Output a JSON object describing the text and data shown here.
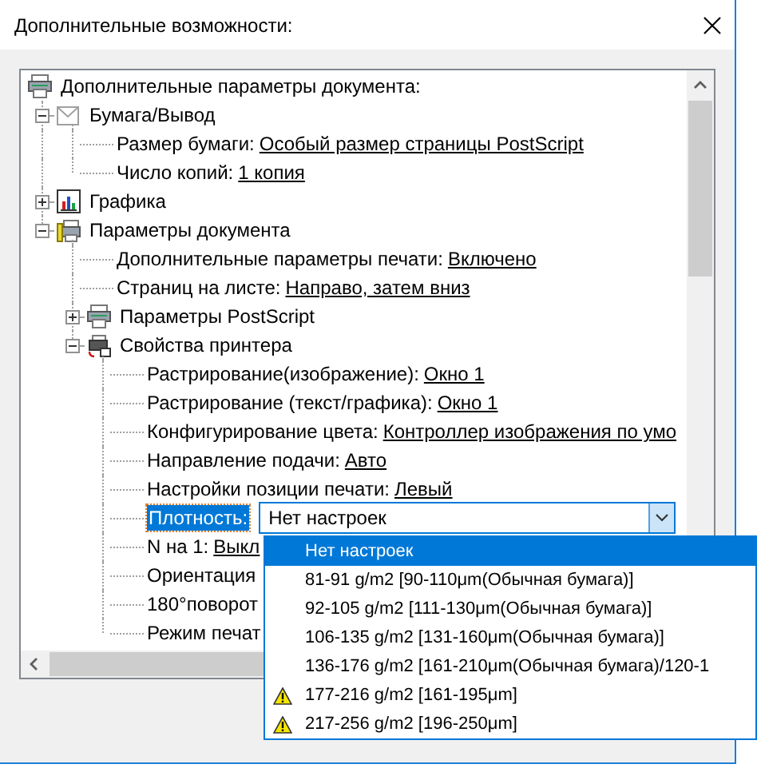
{
  "window": {
    "title": "Дополнительные возможности:"
  },
  "tree": {
    "label": "Дополнительные параметры документа:",
    "kind": "printer",
    "children": [
      {
        "label": "Бумага/Вывод",
        "kind": "paper",
        "expanded": true,
        "children": [
          {
            "label": "Размер бумаги:",
            "value": "Особый размер страницы PostScript"
          },
          {
            "label": "Число копий:",
            "value": "1 копия"
          }
        ]
      },
      {
        "label": "Графика",
        "kind": "chart",
        "expanded": false
      },
      {
        "label": "Параметры документа",
        "kind": "printer-pen",
        "expanded": true,
        "children": [
          {
            "label": "Дополнительные параметры печати:",
            "value": "Включено"
          },
          {
            "label": "Страниц на листе:",
            "value": "Направо, затем вниз"
          },
          {
            "label": "Параметры PostScript",
            "kind": "printer",
            "expanded": false
          },
          {
            "label": "Свойства принтера",
            "kind": "printer-props",
            "expanded": true,
            "children": [
              {
                "label": "Растрирование(изображение):",
                "value": "Окно 1"
              },
              {
                "label": "Растрирование (текст/графика):",
                "value": "Окно 1"
              },
              {
                "label": "Конфигурирование цвета:",
                "value": "Контроллер изображения по умо"
              },
              {
                "label": "Направление подачи:",
                "value": "Авто"
              },
              {
                "label": "Настройки позиции печати:",
                "value": "Левый"
              },
              {
                "label": "Плотность:",
                "selected": true,
                "combo": {
                  "value": "Нет настроек",
                  "open": true,
                  "options": [
                    {
                      "label": "Нет настроек",
                      "selected": true,
                      "warning": false
                    },
                    {
                      "label": "81-91 g/m2 [90-110μm(Обычная бумага)]",
                      "selected": false,
                      "warning": false
                    },
                    {
                      "label": "92-105 g/m2 [111-130μm(Обычная бумага)]",
                      "selected": false,
                      "warning": false
                    },
                    {
                      "label": "106-135 g/m2 [131-160μm(Обычная бумага)]",
                      "selected": false,
                      "warning": false
                    },
                    {
                      "label": "136-176 g/m2 [161-210μm(Обычная бумага)/120-1",
                      "selected": false,
                      "warning": false
                    },
                    {
                      "label": "177-216 g/m2 [161-195μm]",
                      "selected": false,
                      "warning": true
                    },
                    {
                      "label": "217-256 g/m2 [196-250μm]",
                      "selected": false,
                      "warning": true
                    }
                  ]
                }
              },
              {
                "label": "N на 1:",
                "value": "Выкл"
              },
              {
                "label": "Ориентация"
              },
              {
                "label": "180°поворот"
              },
              {
                "label": "Режим печат"
              }
            ]
          }
        ]
      }
    ]
  }
}
